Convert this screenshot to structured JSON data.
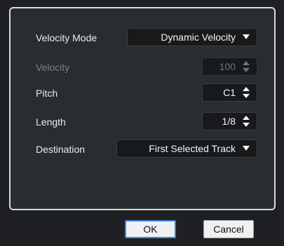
{
  "form": {
    "velocity_mode": {
      "label": "Velocity Mode",
      "value": "Dynamic Velocity"
    },
    "velocity": {
      "label": "Velocity",
      "value": "100",
      "disabled": true
    },
    "pitch": {
      "label": "Pitch",
      "value": "C1"
    },
    "length": {
      "label": "Length",
      "value": "1/8"
    },
    "destination": {
      "label": "Destination",
      "value": "First Selected Track"
    }
  },
  "buttons": {
    "ok": "OK",
    "cancel": "Cancel"
  },
  "icons": {
    "dropdown": "triangle-down-icon",
    "spinner": "up-down-arrows-icon"
  },
  "colors": {
    "panel_border": "#d7dadf",
    "primary_focus": "#3f86d8",
    "background": "#1e2023"
  }
}
